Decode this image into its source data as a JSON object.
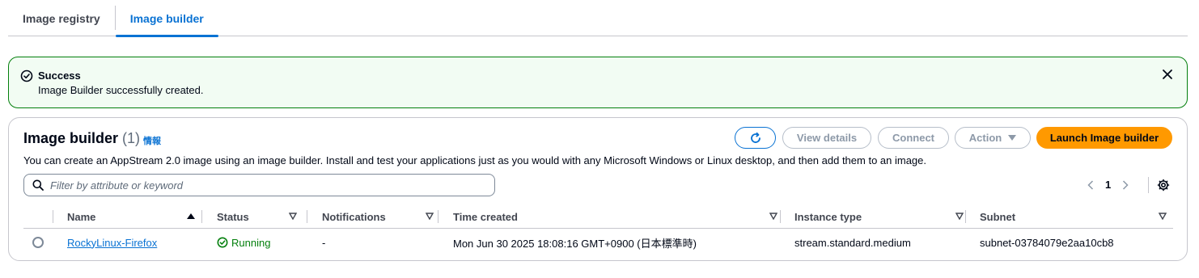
{
  "tabs": [
    {
      "label": "Image registry",
      "active": false
    },
    {
      "label": "Image builder",
      "active": true
    }
  ],
  "flash": {
    "title": "Success",
    "message": "Image Builder successfully created.",
    "close_icon": "close-icon"
  },
  "header": {
    "title": "Image builder",
    "count": "(1)",
    "info": "情報",
    "description": "You can create an AppStream 2.0 image using an image builder. Install and test your applications just as you would with any Microsoft Windows or Linux desktop, and then add them to an image."
  },
  "actions": {
    "refresh_icon": "refresh-icon",
    "view_details": "View details",
    "connect": "Connect",
    "action": "Action",
    "launch": "Launch Image builder"
  },
  "filter": {
    "placeholder": "Filter by attribute or keyword",
    "value": ""
  },
  "pagination": {
    "current_page": "1"
  },
  "table": {
    "columns": [
      "Name",
      "Status",
      "Notifications",
      "Time created",
      "Instance type",
      "Subnet"
    ],
    "rows": [
      {
        "name": "RockyLinux-Firefox",
        "status": "Running",
        "notifications": "-",
        "time_created": "Mon Jun 30 2025 18:08:16 GMT+0900 (日本標準時)",
        "instance_type": "stream.standard.medium",
        "subnet": "subnet-03784079e2aa10cb8"
      }
    ]
  },
  "colors": {
    "accent": "#0972d3",
    "success": "#037f0c",
    "primary_button": "#ff9900"
  }
}
